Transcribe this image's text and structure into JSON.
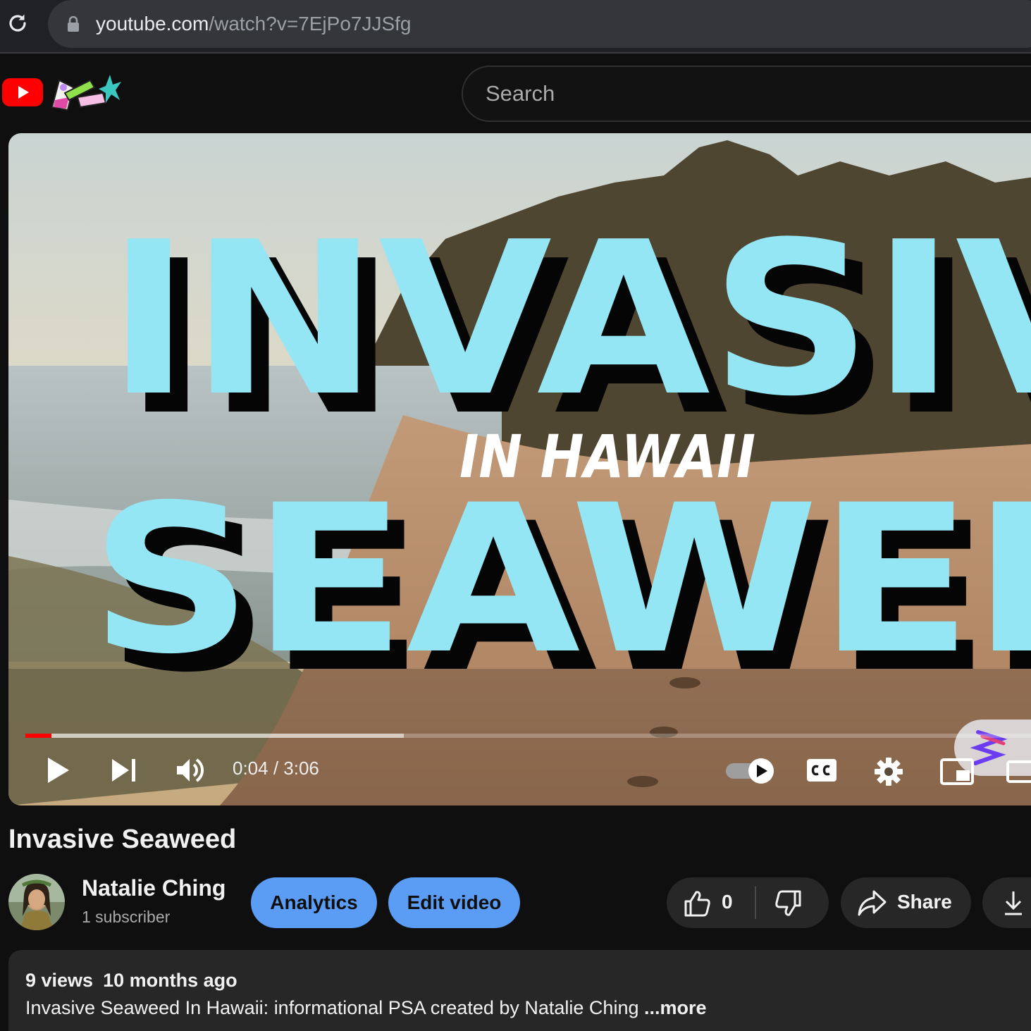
{
  "browser": {
    "url_host": "youtube.com",
    "url_path": "/watch?v=7EjPo7JJSfg"
  },
  "header": {
    "search_placeholder": "Search"
  },
  "video_frame": {
    "headline_top": "INVASIV",
    "headline_middle": "IN HAWAII",
    "headline_bottom": "SEAWEE"
  },
  "player": {
    "current_time": "0:04",
    "duration": "3:06",
    "time_display": "0:04 / 3:06",
    "played_fraction": 0.026,
    "buffered_fraction": 0.373,
    "autoplay": true
  },
  "video": {
    "title": "Invasive Seaweed"
  },
  "channel": {
    "name": "Natalie Ching",
    "subscribers": "1 subscriber"
  },
  "actions": {
    "analytics_label": "Analytics",
    "edit_label": "Edit video",
    "like_count": "0",
    "share_label": "Share"
  },
  "description": {
    "views": "9 views",
    "age": "10 months ago",
    "text": "Invasive Seaweed In Hawaii: informational PSA created by Natalie Ching ",
    "more_label": "...more"
  },
  "colors": {
    "accent_blue": "#5b9df5",
    "progress_red": "#ff0000",
    "headline_cyan": "#95e6f4"
  }
}
